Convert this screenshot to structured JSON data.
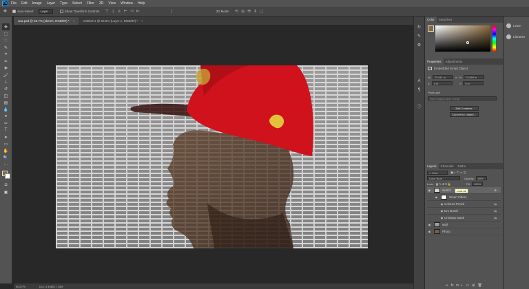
{
  "menubar": {
    "logo": "Ps",
    "items": [
      "File",
      "Edit",
      "Image",
      "Layer",
      "Type",
      "Select",
      "Filter",
      "3D",
      "View",
      "Window",
      "Help"
    ]
  },
  "options": {
    "auto_select_label": "Auto-Select:",
    "auto_select_value": "Layer",
    "transform_label": "Show Transform Controls",
    "mode_3d": "3D Mode:"
  },
  "tabs": [
    {
      "label": "ana.psd @ 66.7% (sketch, RGB/8#) *",
      "active": true
    },
    {
      "label": "Untitled-1 @ 66.6% (Layer 1, RGB/8#) *",
      "active": false
    }
  ],
  "status": {
    "zoom": "66.67%",
    "doc": "Doc: 4.46M/17.19M"
  },
  "color_panel": {
    "tabs": [
      "Color",
      "Swatches"
    ],
    "fg_color": "#8a6a3a"
  },
  "properties": {
    "tabs": [
      "Properties",
      "Adjustments"
    ],
    "title": "Embedded Smart Object",
    "w_label": "W:",
    "w_value": "23.611 in",
    "h_label": "H:",
    "h_value": "13.889 in",
    "x_label": "X:",
    "x_value": "0 in",
    "y_label": "Y:",
    "y_value": "0 in",
    "file": "Photo.psb",
    "comp_placeholder": "Don't Apply Layer Comp",
    "edit_button": "Edit Contents",
    "convert_button": "Convert to Linked..."
  },
  "layers": {
    "tabs": [
      "Layers",
      "Channels",
      "Paths"
    ],
    "filter_label": "Kind",
    "blend_mode": "Color Burn",
    "opacity_label": "Opacity:",
    "opacity_value": "69%",
    "lock_label": "Lock:",
    "fill_label": "Fill:",
    "fill_value": "100%",
    "tooltip": "Lock all",
    "rows": [
      {
        "name": "sketch",
        "selected": true,
        "thumb": "#d9d2c8"
      },
      {
        "name": "Smart Filters",
        "indent": 1,
        "thumb": "#ffffff"
      },
      {
        "name": "Colored Pencil",
        "indent": 2
      },
      {
        "name": "Dry Brush",
        "indent": 2
      },
      {
        "name": "Unsharp Mask",
        "indent": 2
      },
      {
        "name": "wall",
        "thumb": "#9a9a9a"
      },
      {
        "name": "Photo",
        "thumb": "#7a5a4a"
      }
    ]
  },
  "learn_panel": {
    "items": [
      "Learn",
      "Libraries"
    ]
  }
}
